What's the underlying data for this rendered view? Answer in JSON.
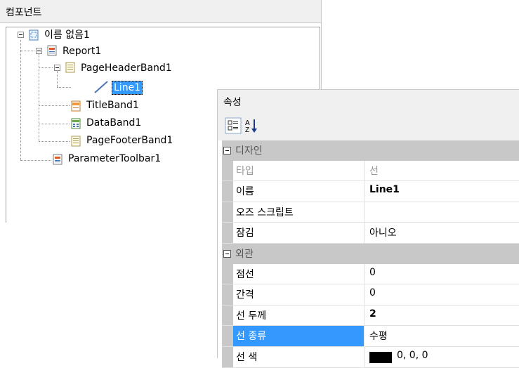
{
  "component_panel": {
    "title": "컴포넌트",
    "tree": {
      "root": "이름 없음1",
      "report": "Report1",
      "page_header_band": "PageHeaderBand1",
      "line": "Line1",
      "title_band": "TitleBand1",
      "data_band": "DataBand1",
      "page_footer_band": "PageFooterBand1",
      "parameter_toolbar": "ParameterToolbar1"
    }
  },
  "property_panel": {
    "title": "속성",
    "toolbar": {
      "categorized_icon": "categorized-icon",
      "sort_icon": "alphabetical-sort-icon",
      "sort_glyph_top": "A",
      "sort_glyph_bottom": "Z"
    },
    "categories": [
      {
        "label": "디자인",
        "rows": [
          {
            "name": "타입",
            "value": "선",
            "name_gray": true
          },
          {
            "name": "이름",
            "value": "Line1",
            "bold": true
          },
          {
            "name": "오즈 스크립트",
            "value": ""
          },
          {
            "name": "잠김",
            "value": "아니오"
          }
        ]
      },
      {
        "label": "외관",
        "rows": [
          {
            "name": "점선",
            "value": "0"
          },
          {
            "name": "간격",
            "value": "0"
          },
          {
            "name": "선 두께",
            "value": "2",
            "bold": true
          },
          {
            "name": "선 종류",
            "value": "수평",
            "selected": true
          },
          {
            "name": "선 색",
            "value": "0, 0, 0",
            "swatch_color": "#000000"
          }
        ]
      }
    ]
  },
  "colors": {
    "selection": "#3399ff",
    "category_bg": "#c8c8c8",
    "panel_bg": "#f0f0f0"
  }
}
